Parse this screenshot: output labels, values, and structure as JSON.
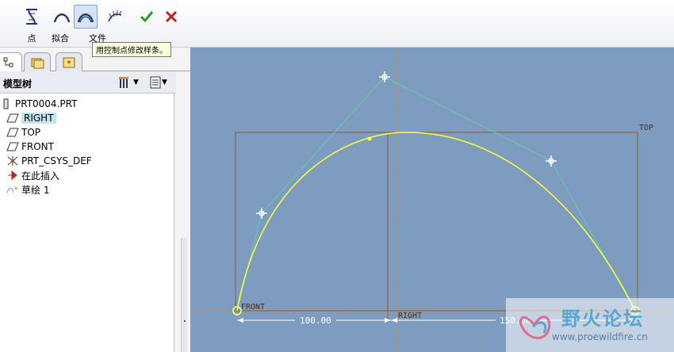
{
  "toolbar": {
    "tools": [
      {
        "name": "point",
        "label": "点"
      },
      {
        "name": "fit",
        "label": "拟合"
      },
      {
        "name": "file",
        "label": "文件"
      },
      {
        "name": "curvature-analysis",
        "label": ""
      }
    ],
    "tooltip": "用控制点修改样条。"
  },
  "model_tree": {
    "title": "模型树",
    "items": [
      {
        "label": "PRT0004.PRT",
        "icon": "part-icon"
      },
      {
        "label": "RIGHT",
        "icon": "datum-plane-icon"
      },
      {
        "label": "TOP",
        "icon": "datum-plane-icon"
      },
      {
        "label": "FRONT",
        "icon": "datum-plane-icon"
      },
      {
        "label": "PRT_CSYS_DEF",
        "icon": "csys-icon"
      },
      {
        "label": "在此插入",
        "icon": "insert-arrow-icon"
      },
      {
        "label": "草绘 1",
        "icon": "sketch-icon"
      }
    ]
  },
  "graphics": {
    "labels": {
      "top": "TOP",
      "front": "FRONT",
      "right": "RIGHT"
    },
    "dims": {
      "d1": "100.00",
      "d2": "150.00"
    }
  },
  "watermark": {
    "title": "野火论坛",
    "url": "www.proewildfire.cn"
  },
  "colors": {
    "viewport": "#7d9cc0",
    "spline": "#ffff33",
    "control_polygon": "#5fd0a8",
    "datum": "#8a5a2b",
    "axis": "#e08a2e"
  }
}
